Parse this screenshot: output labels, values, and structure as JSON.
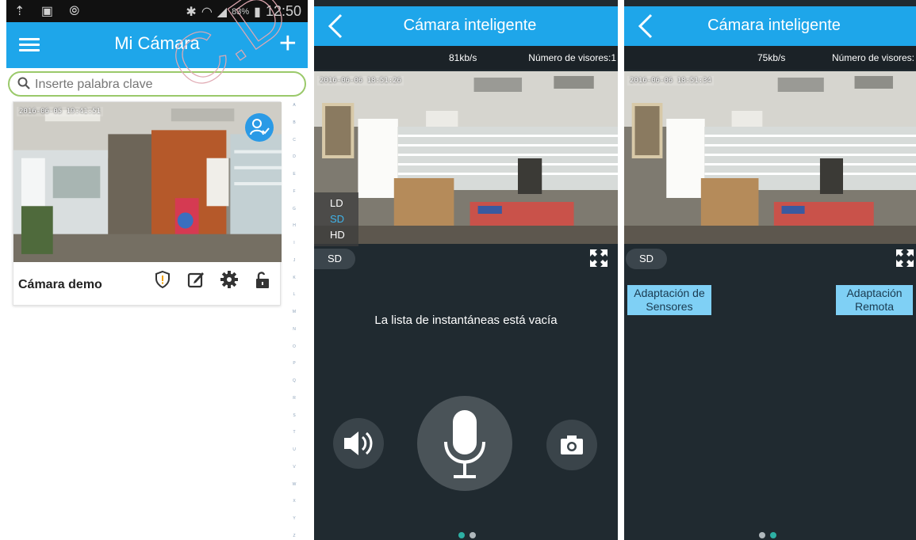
{
  "panel1": {
    "status": {
      "left_icons": "⇡ ▣ ⦾",
      "battery": "83%",
      "time": "12:50"
    },
    "appbar": {
      "title": "Mi Cámara"
    },
    "search": {
      "placeholder": "Inserte palabra clave"
    },
    "camera": {
      "timestamp": "2016-06-05  19:41:51",
      "name": "Cámara demo"
    },
    "alphabet": [
      "A",
      "B",
      "C",
      "D",
      "E",
      "F",
      "G",
      "H",
      "I",
      "J",
      "K",
      "L",
      "M",
      "N",
      "O",
      "P",
      "Q",
      "R",
      "S",
      "T",
      "U",
      "V",
      "W",
      "X",
      "Y",
      "Z"
    ]
  },
  "panel2": {
    "title": "Cámara inteligente",
    "rate": "81kb/s",
    "viewers": "Número de visores:1",
    "timestamp": "2016-06-06  18:51:26",
    "resolutions": [
      "LD",
      "SD",
      "HD"
    ],
    "quality": "SD",
    "empty_message": "La lista de instantáneas está vacía"
  },
  "panel3": {
    "title": "Cámara inteligente",
    "rate": "75kb/s",
    "viewers": "Número de visores:",
    "timestamp": "2016-06-06  18:51:34",
    "quality": "SD",
    "sensor_button": "Adaptación de Sensores",
    "remote_button": "Adaptación Remota"
  },
  "colors": {
    "accent": "#1ea6ea",
    "dark_bg": "#202a30",
    "page_dot_active": "#2db0a4"
  },
  "icons": [
    "menu-icon",
    "add-icon",
    "search-icon",
    "user-check-icon",
    "alert-shield-icon",
    "edit-icon",
    "settings-gear-icon",
    "unlock-icon",
    "back-chevron-icon",
    "fullscreen-icon",
    "speaker-icon",
    "microphone-icon",
    "camera-icon"
  ]
}
